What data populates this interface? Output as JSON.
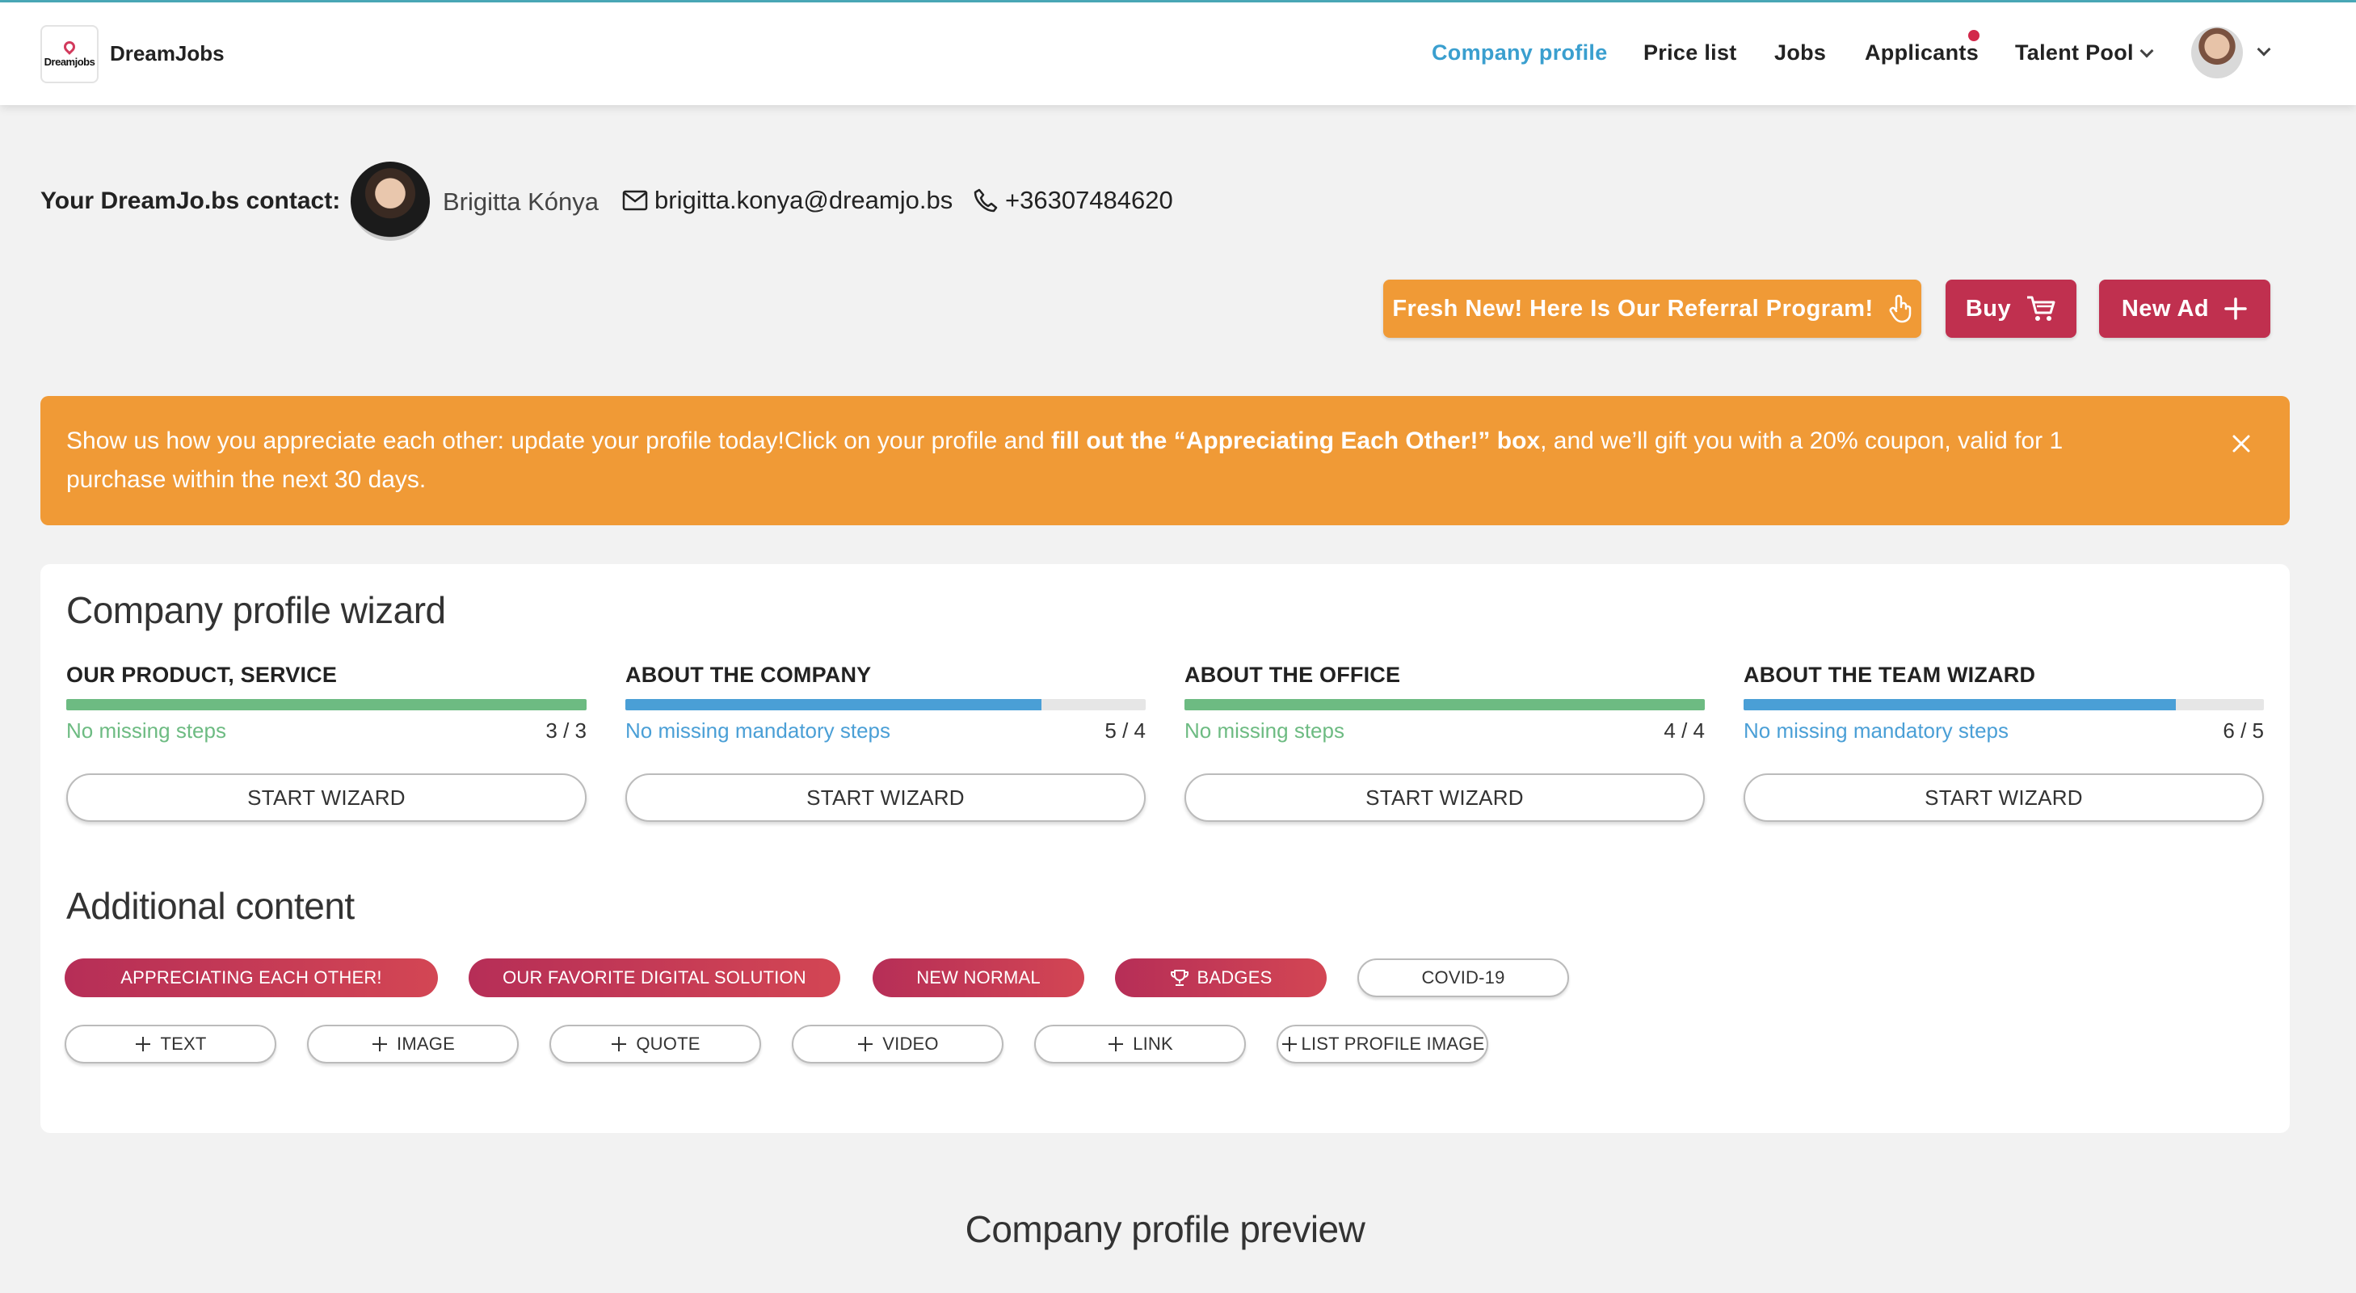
{
  "header": {
    "brand": "DreamJobs",
    "logo_text": "Dreamjobs",
    "nav": [
      {
        "label": "Company profile",
        "active": true
      },
      {
        "label": "Price list",
        "active": false
      },
      {
        "label": "Jobs",
        "active": false
      },
      {
        "label": "Applicants",
        "active": false,
        "notification": true
      },
      {
        "label": "Talent Pool",
        "active": false,
        "dropdown": true
      }
    ]
  },
  "contact": {
    "label": "Your DreamJo.bs contact:",
    "name": "Brigitta Kónya",
    "email": "brigitta.konya@dreamjo.bs",
    "phone": "+36307484620"
  },
  "actions": {
    "referral": "Fresh New! Here Is Our Referral Program!",
    "buy": "Buy",
    "new_ad": "New Ad"
  },
  "banner": {
    "text_start": "Show us how you appreciate each other: update your profile today!Click on your profile and ",
    "text_bold": "fill out the “Appreciating Each Other!” box",
    "text_end": ", and we’ll gift you with a 20% coupon, valid for 1 purchase within the next 30 days."
  },
  "wizard": {
    "title": "Company profile wizard",
    "sections": [
      {
        "title": "OUR PRODUCT, SERVICE",
        "status": "No missing steps",
        "count": "3 / 3",
        "progress": 1.0,
        "button": "START WIZARD"
      },
      {
        "title": "ABOUT THE COMPANY",
        "status": "No missing mandatory steps",
        "count": "5 / 4",
        "progress": 0.8,
        "button": "START WIZARD"
      },
      {
        "title": "ABOUT THE OFFICE",
        "status": "No missing steps",
        "count": "4 / 4",
        "progress": 1.0,
        "button": "START WIZARD"
      },
      {
        "title": "ABOUT THE TEAM WIZARD",
        "status": "No missing mandatory steps",
        "count": "6 / 5",
        "progress": 0.83,
        "button": "START WIZARD"
      }
    ]
  },
  "additional": {
    "title": "Additional content",
    "tags": [
      {
        "label": "APPRECIATING EACH OTHER!",
        "style": "filled"
      },
      {
        "label": "OUR FAVORITE DIGITAL SOLUTION",
        "style": "filled"
      },
      {
        "label": "NEW NORMAL",
        "style": "filled"
      },
      {
        "label": "BADGES",
        "style": "filled",
        "icon": "trophy-icon"
      },
      {
        "label": "COVID-19",
        "style": "outline"
      }
    ],
    "add_buttons": [
      {
        "label": "TEXT",
        "icon": "plus-icon"
      },
      {
        "label": "IMAGE",
        "icon": "plus-icon"
      },
      {
        "label": "QUOTE",
        "icon": "plus-icon"
      },
      {
        "label": "VIDEO",
        "icon": "plus-icon"
      },
      {
        "label": "LINK",
        "icon": "plus-icon"
      },
      {
        "label": "LIST PROFILE IMAGE",
        "icon": "plus-icon"
      }
    ]
  },
  "preview": {
    "title": "Company profile preview"
  },
  "colors": {
    "accent_blue": "#3a9fcf",
    "green": "#6dbb82",
    "blue_bar": "#4a9fd6",
    "orange": "#f09a36",
    "crimson": "#c0304f",
    "notification": "#d2284a"
  }
}
